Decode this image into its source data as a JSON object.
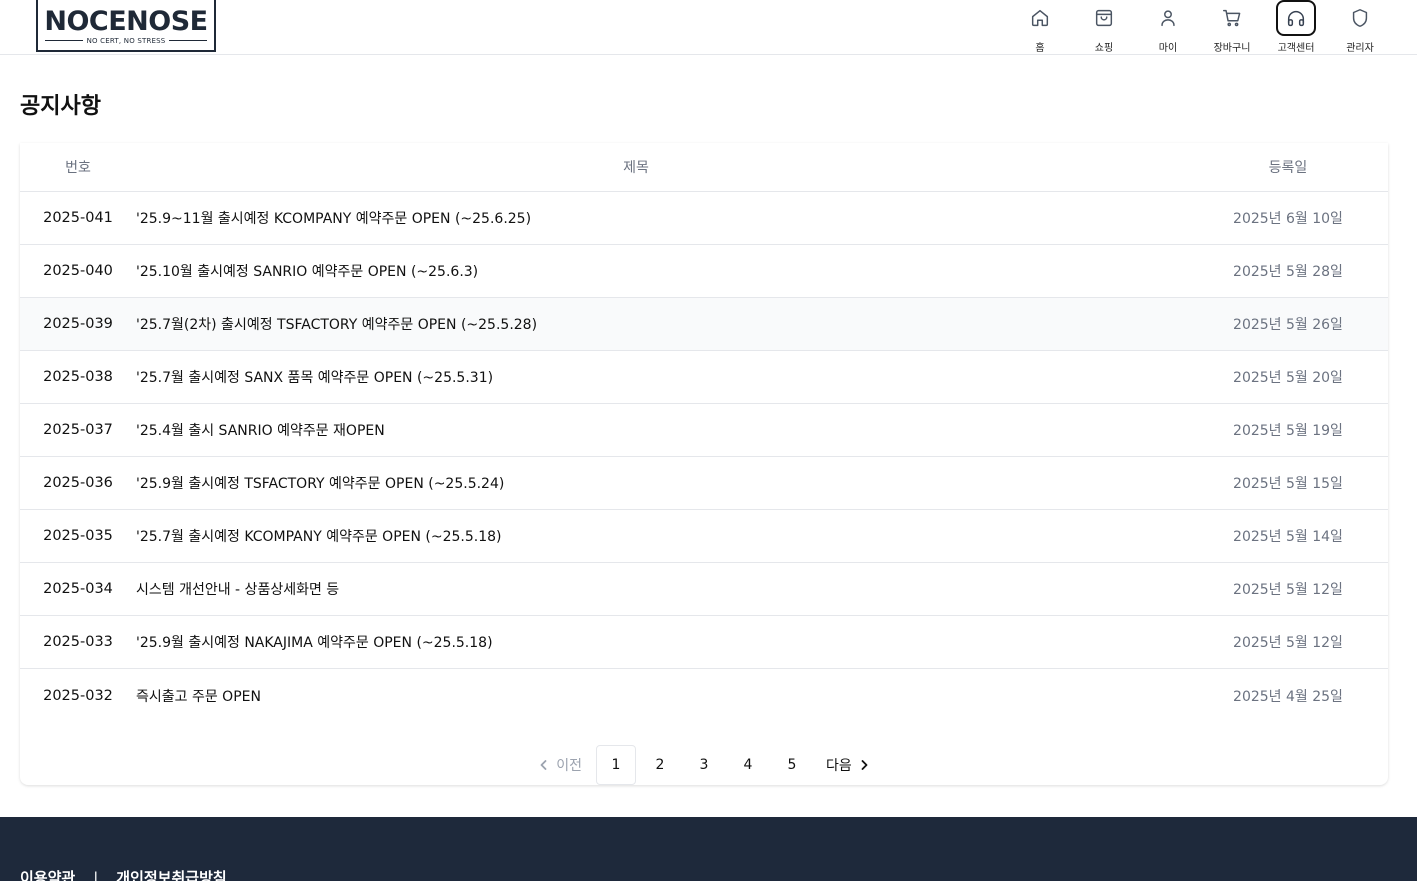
{
  "header": {
    "logo": {
      "main": "NOCENOSE",
      "sub": "NO CERT, NO STRESS"
    },
    "nav": [
      {
        "label": "홈",
        "icon": "home-icon",
        "active": false
      },
      {
        "label": "쇼핑",
        "icon": "shopping-bag-icon",
        "active": false
      },
      {
        "label": "마이",
        "icon": "user-icon",
        "active": false
      },
      {
        "label": "장바구니",
        "icon": "cart-icon",
        "active": false
      },
      {
        "label": "고객센터",
        "icon": "headphones-icon",
        "active": true
      },
      {
        "label": "관리자",
        "icon": "shield-icon",
        "active": false
      }
    ]
  },
  "page": {
    "title": "공지사항"
  },
  "table": {
    "headers": {
      "num": "번호",
      "title": "제목",
      "date": "등록일"
    },
    "rows": [
      {
        "num": "2025-041",
        "title": "'25.9~11월 출시예정 KCOMPANY 예약주문 OPEN (~25.6.25)",
        "date": "2025년 6월 10일"
      },
      {
        "num": "2025-040",
        "title": "'25.10월 출시예정 SANRIO 예약주문 OPEN (~25.6.3)",
        "date": "2025년 5월 28일"
      },
      {
        "num": "2025-039",
        "title": "'25.7월(2차) 출시예정 TSFACTORY 예약주문 OPEN (~25.5.28)",
        "date": "2025년 5월 26일"
      },
      {
        "num": "2025-038",
        "title": "'25.7월 출시예정 SANX 품목 예약주문 OPEN (~25.5.31)",
        "date": "2025년 5월 20일"
      },
      {
        "num": "2025-037",
        "title": "'25.4월 출시 SANRIO 예약주문 재OPEN",
        "date": "2025년 5월 19일"
      },
      {
        "num": "2025-036",
        "title": "'25.9월 출시예정 TSFACTORY 예약주문 OPEN (~25.5.24)",
        "date": "2025년 5월 15일"
      },
      {
        "num": "2025-035",
        "title": "'25.7월 출시예정 KCOMPANY 예약주문 OPEN (~25.5.18)",
        "date": "2025년 5월 14일"
      },
      {
        "num": "2025-034",
        "title": "시스템 개선안내 - 상품상세화면 등",
        "date": "2025년 5월 12일"
      },
      {
        "num": "2025-033",
        "title": "'25.9월 출시예정 NAKAJIMA 예약주문 OPEN (~25.5.18)",
        "date": "2025년 5월 12일"
      },
      {
        "num": "2025-032",
        "title": "즉시출고 주문 OPEN",
        "date": "2025년 4월 25일"
      }
    ],
    "highlighted_row": 2
  },
  "pagination": {
    "prev_label": "이전",
    "next_label": "다음",
    "pages": [
      "1",
      "2",
      "3",
      "4",
      "5"
    ],
    "current": "1"
  },
  "footer": {
    "links": [
      "이용약관",
      "개인정보취급방침"
    ],
    "separator": "|"
  }
}
